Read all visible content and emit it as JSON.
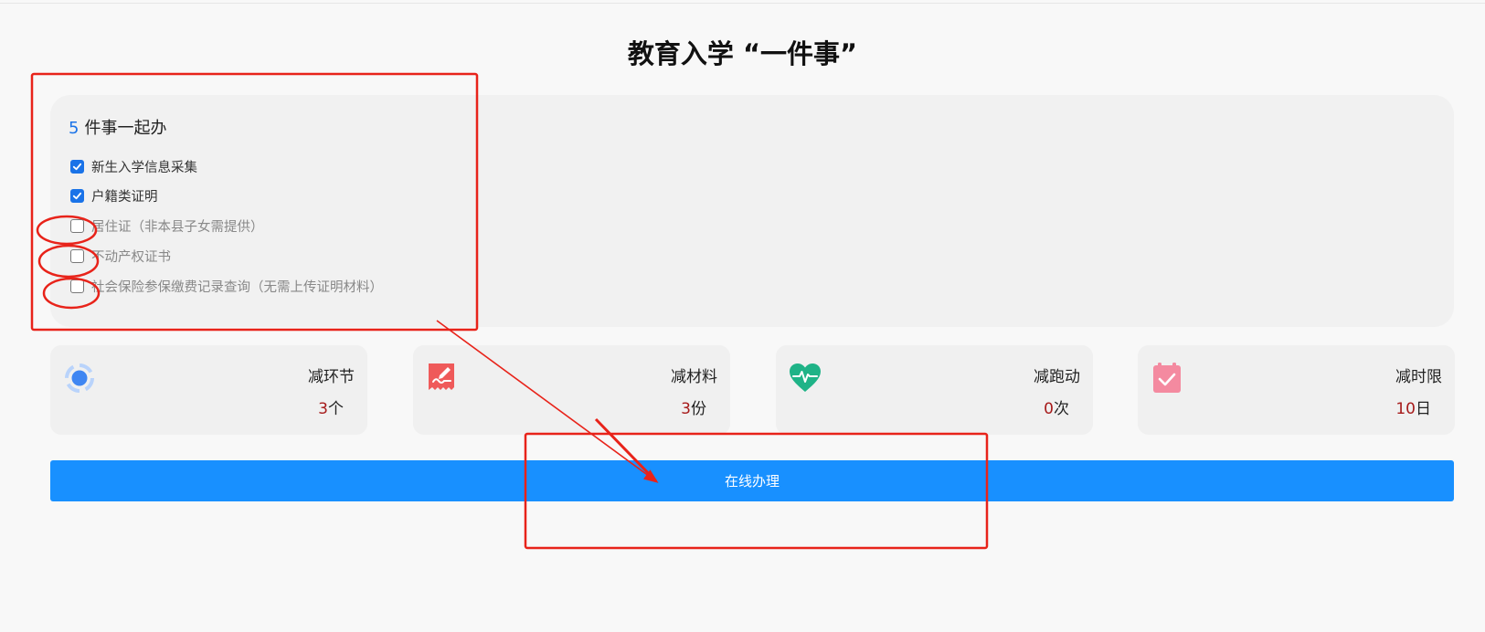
{
  "page": {
    "title": "教育入学 “一件事”"
  },
  "panel": {
    "count": "5",
    "heading": "件事一起办",
    "items": [
      {
        "label": "新生入学信息采集",
        "checked": true
      },
      {
        "label": "户籍类证明",
        "checked": true
      },
      {
        "label": "居住证（非本县子女需提供）",
        "checked": false
      },
      {
        "label": "不动产权证书",
        "checked": false
      },
      {
        "label": "社会保险参保缴费记录查询（无需上传证明材料）",
        "checked": false
      }
    ]
  },
  "stats": [
    {
      "label": "减环节",
      "value": "3",
      "unit": "个",
      "icon": "process-steps-icon",
      "color": "#4a90f5"
    },
    {
      "label": "减材料",
      "value": "3",
      "unit": "份",
      "icon": "document-sign-icon",
      "color": "#ef5a5a"
    },
    {
      "label": "减跑动",
      "value": "0",
      "unit": "次",
      "icon": "heart-pulse-icon",
      "color": "#1fb387"
    },
    {
      "label": "减时限",
      "value": "10",
      "unit": "日",
      "icon": "calendar-check-icon",
      "color": "#f07f97"
    }
  ],
  "action": {
    "apply_label": "在线办理"
  },
  "colors": {
    "accent": "#1890ff",
    "annotation": "#e8231a",
    "stat_number": "#a61a1a"
  }
}
